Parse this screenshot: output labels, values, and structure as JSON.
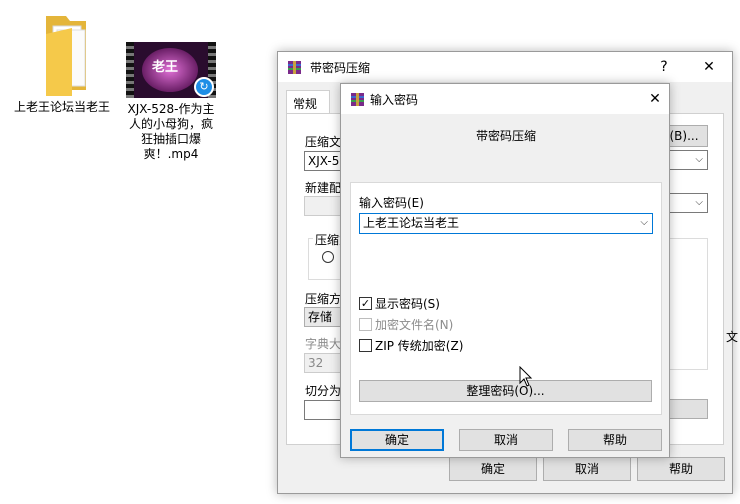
{
  "desktop": {
    "folder_label": "上老王论坛当老王",
    "video_label": "XJX-528-作为主人的小母狗，疯狂抽插口爆爽！.mp4",
    "video_thumb_text": "老王"
  },
  "back_dialog": {
    "title": "带密码压缩",
    "help_glyph": "?",
    "close_glyph": "✕",
    "tab_general": "常规",
    "archive_label": "压缩文",
    "archive_value": "XJX-52",
    "browse_label": "(B)...",
    "new_label": "新建配",
    "format_label": "压缩方",
    "method_label": "压缩方",
    "method_value": "存储",
    "dict_label": "字典大",
    "dict_value": "32",
    "split_label": "切分为",
    "side_char": "文",
    "ok": "确定",
    "cancel": "取消",
    "help": "帮助"
  },
  "dialog": {
    "title": "输入密码",
    "close_glyph": "✕",
    "heading": "带密码压缩",
    "password_label": "输入密码(E)",
    "password_value": "上老王论坛当老王",
    "show_password": "显示密码(S)",
    "encrypt_names": "加密文件名(N)",
    "zip_legacy": "ZIP 传统加密(Z)",
    "check_mark": "✓",
    "organize": "整理密码(O)...",
    "ok": "确定",
    "cancel": "取消",
    "help": "帮助"
  },
  "colors": {
    "accent": "#0078d7",
    "folder": "#f5c94a"
  }
}
